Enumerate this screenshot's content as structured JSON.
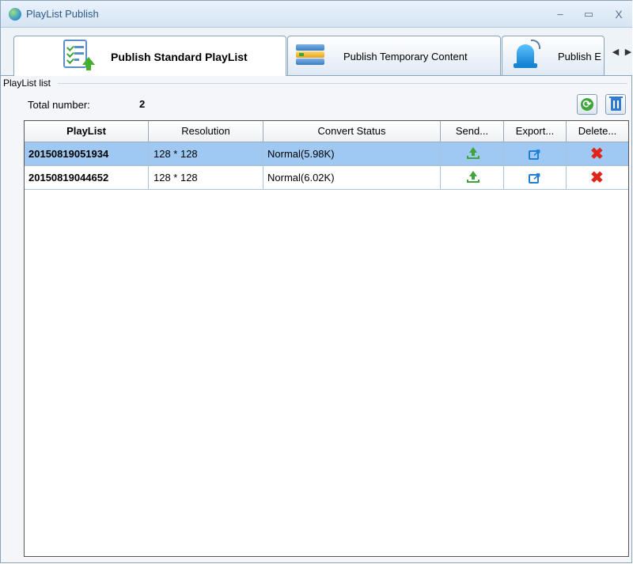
{
  "window": {
    "title": "PlayList Publish",
    "minimize": "–",
    "maximize": "▭",
    "close": "X"
  },
  "tabs": [
    {
      "label": "Publish Standard PlayList",
      "icon": "checklist-upload-icon",
      "active": true
    },
    {
      "label": "Publish Temporary Content",
      "icon": "server-icon",
      "active": false
    },
    {
      "label": "Publish E",
      "icon": "bell-icon",
      "active": false
    }
  ],
  "tab_scroll": {
    "left": "◀",
    "right": "▶"
  },
  "list": {
    "group_label": "PlayList list",
    "total_label": "Total number:",
    "total_value": "2",
    "columns": [
      "PlayList",
      "Resolution",
      "Convert Status",
      "Send...",
      "Export...",
      "Delete..."
    ],
    "rows": [
      {
        "playlist": "20150819051934",
        "resolution": "128 * 128",
        "status": "Normal(5.98K)",
        "selected": true
      },
      {
        "playlist": "20150819044652",
        "resolution": "128 * 128",
        "status": "Normal(6.02K)",
        "selected": false
      }
    ]
  },
  "colors": {
    "selected_row": "#9fc9f2",
    "send": "#3fa43a",
    "export": "#1f7fd6",
    "delete": "#e2231a"
  }
}
